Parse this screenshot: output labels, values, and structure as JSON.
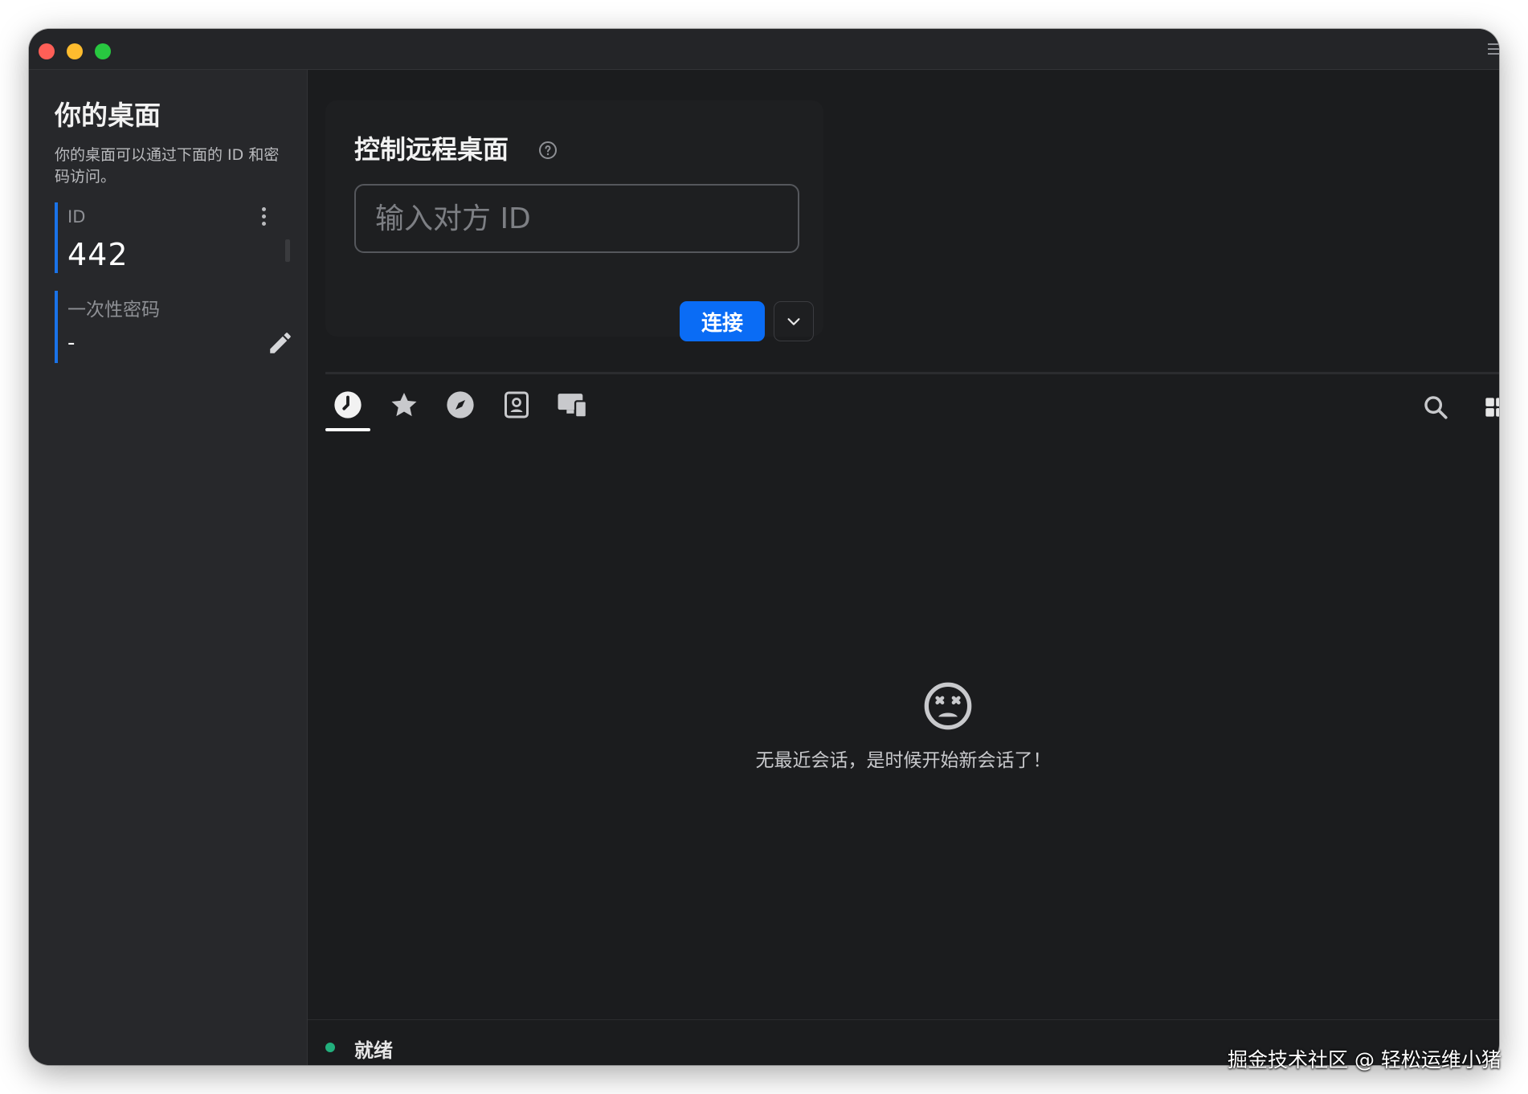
{
  "sidebar": {
    "title": "你的桌面",
    "description": "你的桌面可以通过下面的 ID 和密码访问。",
    "id_label": "ID",
    "id_value": "442",
    "password_label": "一次性密码",
    "password_value": "-"
  },
  "connect": {
    "title": "控制远程桌面",
    "input_placeholder": "输入对方 ID",
    "input_value": "",
    "connect_label": "连接"
  },
  "tabs": [
    {
      "name": "recent",
      "icon": "clock-icon",
      "active": true
    },
    {
      "name": "favorites",
      "icon": "star-icon",
      "active": false
    },
    {
      "name": "discovered",
      "icon": "compass-icon",
      "active": false
    },
    {
      "name": "address-book",
      "icon": "contact-icon",
      "active": false
    },
    {
      "name": "devices",
      "icon": "devices-icon",
      "active": false
    }
  ],
  "empty_state": {
    "icon": "sad-face-icon",
    "message": "无最近会话，是时候开始新会话了！"
  },
  "status": {
    "text": "就绪",
    "color": "#22b07d"
  },
  "watermark": "掘金技术社区 @ 轻松运维小猪",
  "colors": {
    "accent": "#0a6cf5",
    "background": "#1b1c1e",
    "sidebar": "#27282b"
  }
}
